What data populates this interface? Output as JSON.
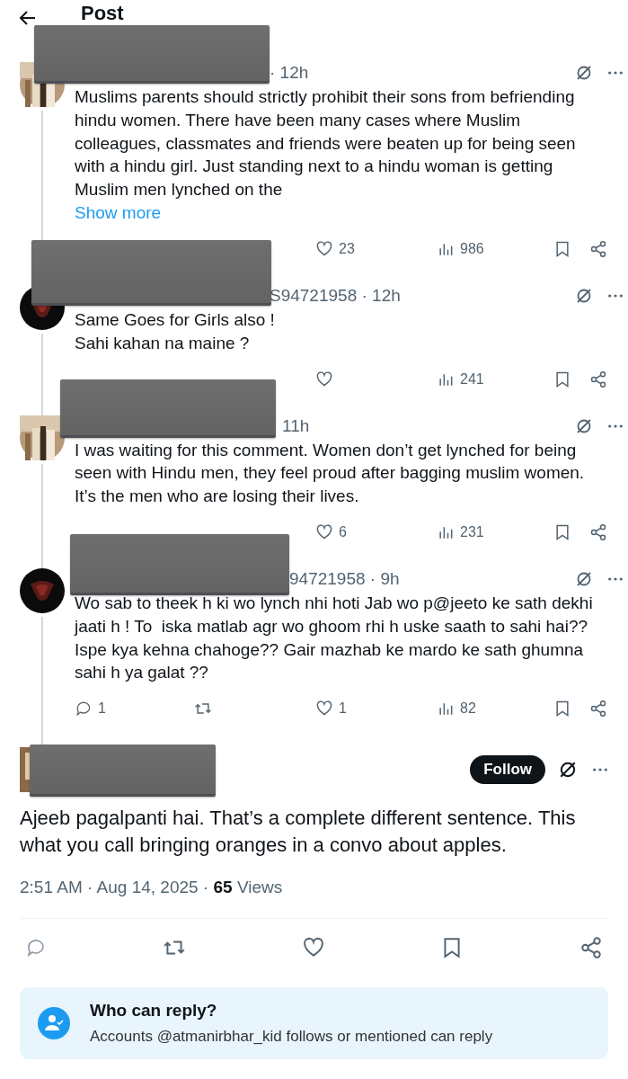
{
  "header": {
    "title": "Post"
  },
  "replies": [
    {
      "avatar": {
        "kind": "warm"
      },
      "redacted": true,
      "meta": "· 12h",
      "text": "Muslims parents should strictly prohibit their sons from befriending hindu women. There have been many cases where Muslim colleagues, classmates and friends were beaten up for being seen with a hindu girl. Just standing next to a hindu woman is getting Muslim men lynched on the",
      "show_more": "Show more",
      "actions": [
        {
          "kind": "like",
          "count": "23"
        },
        {
          "kind": "views",
          "count": "986"
        },
        {
          "kind": "bookmark"
        },
        {
          "kind": "share"
        }
      ]
    },
    {
      "avatar": {
        "kind": "dark"
      },
      "redacted": true,
      "meta": "S94721958 · 12h",
      "text": "Same Goes for Girls also !\nSahi kahan na maine ?",
      "actions": [
        {
          "kind": "like"
        },
        {
          "kind": "views",
          "count": "241"
        },
        {
          "kind": "bookmark"
        },
        {
          "kind": "share"
        }
      ]
    },
    {
      "avatar": {
        "kind": "warm"
      },
      "redacted": true,
      "meta": "11h",
      "text": "I was waiting for this comment. Women don’t get lynched for being seen with Hindu men, they feel proud after bagging muslim women. It’s the men who are losing their lives.",
      "actions": [
        {
          "kind": "like",
          "count": "6"
        },
        {
          "kind": "views",
          "count": "231"
        },
        {
          "kind": "bookmark"
        },
        {
          "kind": "share"
        }
      ]
    },
    {
      "avatar": {
        "kind": "dark"
      },
      "redacted": true,
      "meta": "94721958 · 9h",
      "text": "Wo sab to theek h ki wo lynch nhi hoti Jab wo p@jeeto ke sath dekhi jaati h ! To  iska matlab agr wo ghoom rhi h uske saath to sahi hai?? Ispe kya kehna chahoge?? Gair mazhab ke mardo ke sath ghumna sahi h ya galat ??",
      "actions": [
        {
          "kind": "reply",
          "count": "1"
        },
        {
          "kind": "retweet"
        },
        {
          "kind": "like",
          "count": "1"
        },
        {
          "kind": "views",
          "count": "82"
        },
        {
          "kind": "bookmark"
        },
        {
          "kind": "share"
        }
      ]
    }
  ],
  "main": {
    "avatar": {
      "kind": "warm"
    },
    "redacted": true,
    "follow": "Follow",
    "text": "Ajeeb pagalpanti hai. That’s a complete different sentence. This what you call bringing oranges in a convo about apples.",
    "meta": "2:51 AM · Aug 14, 2025 · **65** Views",
    "actions": [
      {
        "kind": "reply"
      },
      {
        "kind": "retweet"
      },
      {
        "kind": "like"
      },
      {
        "kind": "bookmark"
      },
      {
        "kind": "share"
      }
    ]
  },
  "who_can_reply": {
    "title": "Who can reply?",
    "text": "Accounts @atmanirbhar_kid follows or mentioned can reply"
  }
}
